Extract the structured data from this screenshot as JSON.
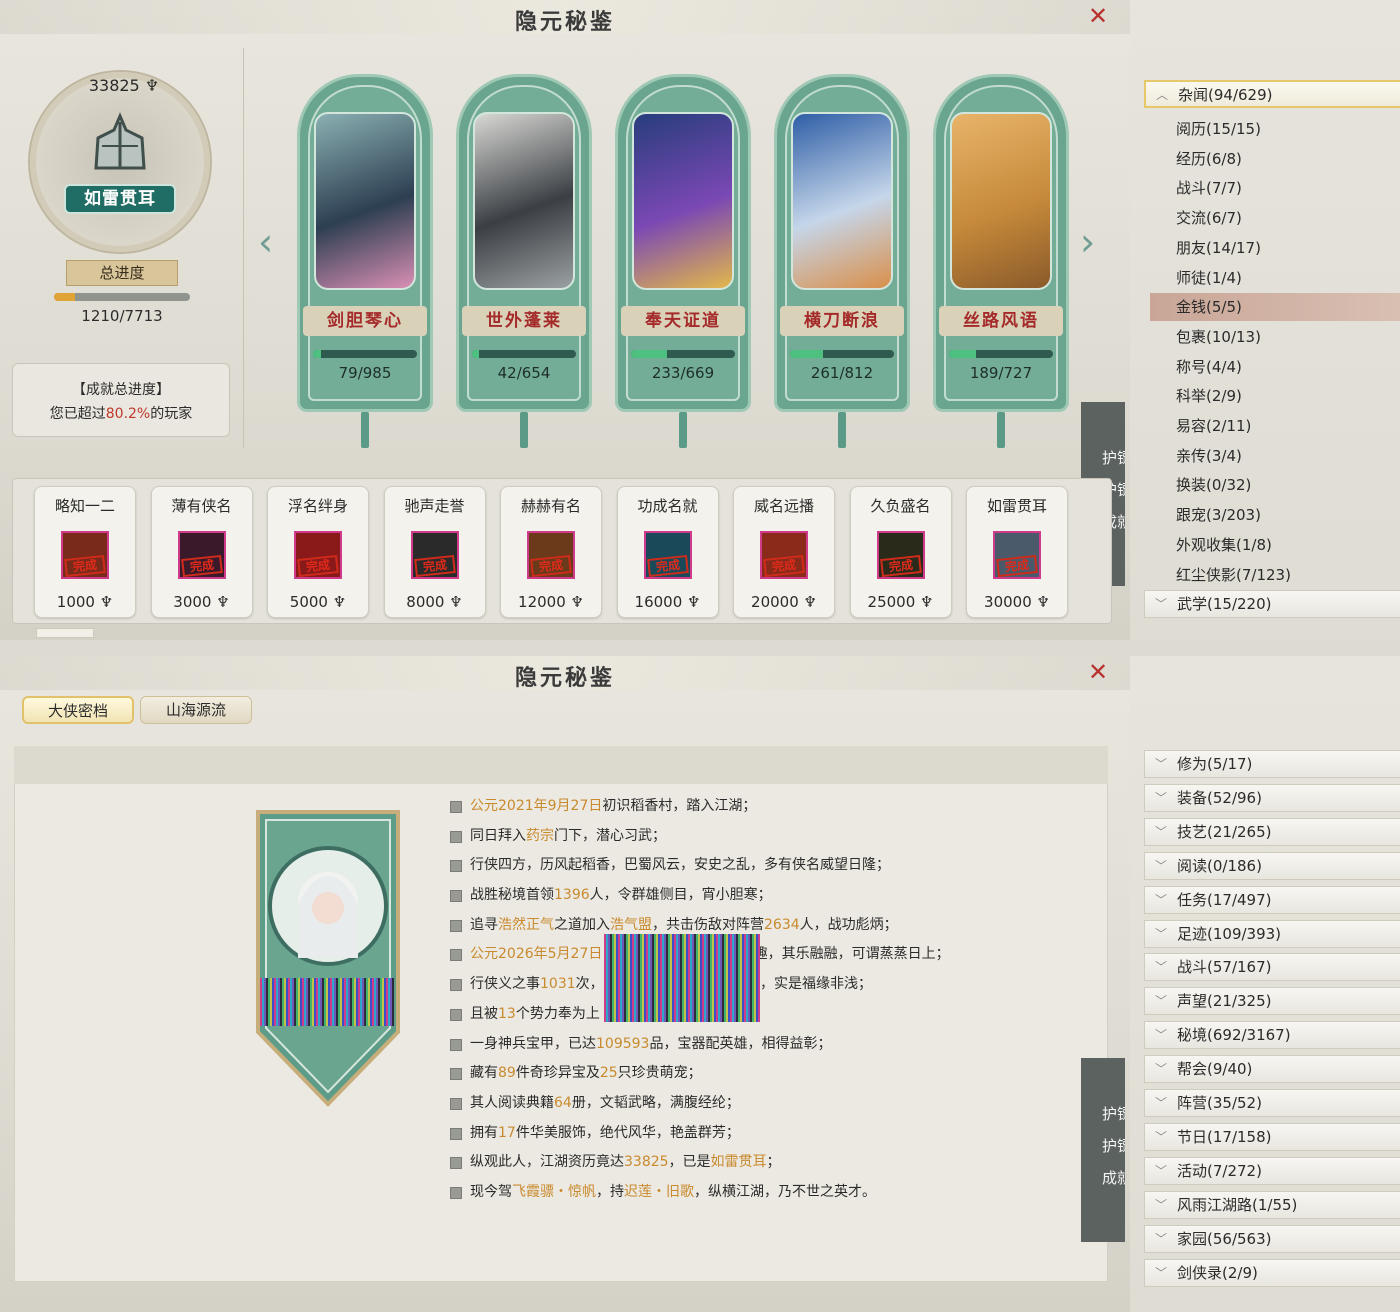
{
  "window": {
    "title": "隐元秘鉴",
    "close_label": "✕"
  },
  "colors": {
    "accent": "#c98a2e",
    "highlight_red": "#c0392b",
    "card_green": "#6aa58f",
    "progress_green": "#4ec07f",
    "gold": "#e0a336"
  },
  "player": {
    "score": "33825",
    "rank_title": "如雷贯耳",
    "progress_label": "总进度",
    "progress_text": "1210/7713",
    "progress_fraction": 0.157,
    "achievement_title": "【成就总进度】",
    "achievement_prefix": "您已超过",
    "achievement_percent": "80.2%",
    "achievement_suffix": "的玩家"
  },
  "carousel": {
    "prev": "‹",
    "next": "›",
    "cards": [
      {
        "title": "剑胆琴心",
        "progress": "79/985",
        "fraction": 0.08
      },
      {
        "title": "世外蓬莱",
        "progress": "42/654",
        "fraction": 0.064
      },
      {
        "title": "奉天证道",
        "progress": "233/669",
        "fraction": 0.348
      },
      {
        "title": "横刀断浪",
        "progress": "261/812",
        "fraction": 0.321
      },
      {
        "title": "丝路风语",
        "progress": "189/727",
        "fraction": 0.26
      }
    ]
  },
  "side_tab": {
    "lines": [
      "护镖",
      "护镖",
      "成就"
    ]
  },
  "tiers": [
    {
      "name": "略知一二",
      "value": "1000",
      "stamp": "完成"
    },
    {
      "name": "薄有侠名",
      "value": "3000",
      "stamp": "完成"
    },
    {
      "name": "浮名绊身",
      "value": "5000",
      "stamp": "完成"
    },
    {
      "name": "驰声走誉",
      "value": "8000",
      "stamp": "完成"
    },
    {
      "name": "赫赫有名",
      "value": "12000",
      "stamp": "完成"
    },
    {
      "name": "功成名就",
      "value": "16000",
      "stamp": "完成"
    },
    {
      "name": "威名远播",
      "value": "20000",
      "stamp": "完成"
    },
    {
      "name": "久负盛名",
      "value": "25000",
      "stamp": "完成"
    },
    {
      "name": "如雷贯耳",
      "value": "30000",
      "stamp": "完成"
    }
  ],
  "sidebar_top": {
    "header": "杂闻(94/629)",
    "items": [
      "阅历(15/15)",
      "经历(6/8)",
      "战斗(7/7)",
      "交流(6/7)",
      "朋友(14/17)",
      "师徒(1/4)",
      "金钱(5/5)",
      "包裹(10/13)",
      "称号(4/4)",
      "科举(2/9)",
      "易容(2/11)",
      "亲传(3/4)",
      "换装(0/32)",
      "跟宠(3/203)",
      "外观收集(1/8)",
      "红尘侠影(7/123)"
    ],
    "selected": "金钱(5/5)",
    "footer": "武学(15/220)"
  },
  "tabs": {
    "archive": "大侠密档",
    "origins": "山海源流"
  },
  "bio": [
    [
      [
        "公元2021年9月27日",
        1
      ],
      [
        "初识稻香村，踏入江湖；",
        0
      ]
    ],
    [
      [
        "同日拜入",
        0
      ],
      [
        "药宗",
        1
      ],
      [
        "门下，潜心习武；",
        0
      ]
    ],
    [
      [
        "行侠四方，历风起稻香，巴蜀风云，安史之乱，多有侠名威望日隆；",
        0
      ]
    ],
    [
      [
        "战胜秘境首领",
        0
      ],
      [
        "1396",
        1
      ],
      [
        "人，令群雄侧目，宵小胆寒；",
        0
      ]
    ],
    [
      [
        "追寻",
        0
      ],
      [
        "浩然正气",
        1
      ],
      [
        "之道加入",
        0
      ],
      [
        "浩气盟",
        1
      ],
      [
        "，共击伤敌对阵营",
        0
      ],
      [
        "2634",
        1
      ],
      [
        "人，战功彪炳；",
        0
      ]
    ],
    [
      [
        "公元2026年5月27日",
        1
      ],
      [
        "                                  ",
        0
      ],
      [
        "趣，其乐融融，可谓蒸蒸日上；",
        0
      ]
    ],
    [
      [
        "行侠义之事",
        0
      ],
      [
        "1031",
        1
      ],
      [
        "次，                                ",
        0
      ],
      [
        "遇，实是福缘非浅；",
        0
      ]
    ],
    [
      [
        "且被",
        0
      ],
      [
        "13",
        1
      ],
      [
        "个势力奉为上",
        0
      ]
    ],
    [
      [
        "一身神兵宝甲，已达",
        0
      ],
      [
        "109593",
        1
      ],
      [
        "品，宝器配英雄，相得益彰；",
        0
      ]
    ],
    [
      [
        "藏有",
        0
      ],
      [
        "89",
        1
      ],
      [
        "件奇珍异宝及",
        0
      ],
      [
        "25",
        1
      ],
      [
        "只珍贵萌宠；",
        0
      ]
    ],
    [
      [
        "其人阅读典籍",
        0
      ],
      [
        "64",
        1
      ],
      [
        "册，文韬武略，满腹经纶；",
        0
      ]
    ],
    [
      [
        "拥有",
        0
      ],
      [
        "17",
        1
      ],
      [
        "件华美服饰，绝代风华，艳盖群芳；",
        0
      ]
    ],
    [
      [
        "纵观此人，江湖资历竟达",
        0
      ],
      [
        "33825",
        1
      ],
      [
        "，已是",
        0
      ],
      [
        "如雷贯耳",
        1
      ],
      [
        "；",
        0
      ]
    ],
    [
      [
        "现今驾",
        0
      ],
      [
        "飞霞骠・惊帆",
        1
      ],
      [
        "，持",
        0
      ],
      [
        "迟莲・旧歌",
        1
      ],
      [
        "，纵横江湖，乃不世之英才。",
        0
      ]
    ]
  ],
  "sidebar_bottom": [
    "修为(5/17)",
    "装备(52/96)",
    "技艺(21/265)",
    "阅读(0/186)",
    "任务(17/497)",
    "足迹(109/393)",
    "战斗(57/167)",
    "声望(21/325)",
    "秘境(692/3167)",
    "帮会(9/40)",
    "阵营(35/52)",
    "节日(17/158)",
    "活动(7/272)",
    "风雨江湖路(1/55)",
    "家园(56/563)",
    "剑侠录(2/9)"
  ]
}
